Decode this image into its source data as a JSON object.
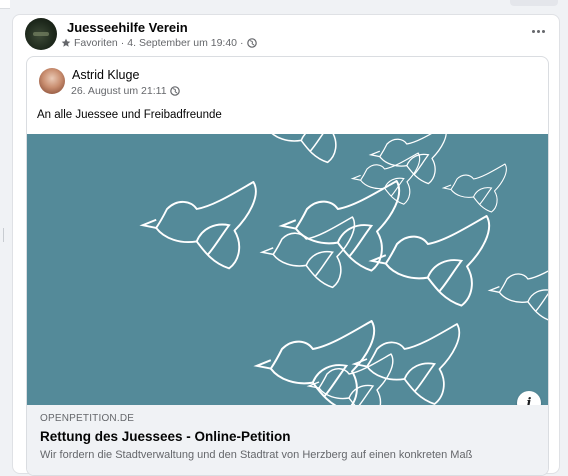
{
  "post": {
    "group_name": "Juesseehilfe Verein",
    "favorites_label": "Favoriten",
    "date": "4. September um 19:40",
    "separator": "·",
    "icons": {
      "favorites": "star-icon",
      "audience": "globe-icon",
      "more": "more-options-icon"
    }
  },
  "shared_post": {
    "author": "Astrid Kluge",
    "date": "26. August um 21:11",
    "separator": "·",
    "text": "An alle Juessee und Freibadfreunde",
    "icons": {
      "audience": "globe-icon"
    }
  },
  "link_preview": {
    "image_description_colors": {
      "background": "#548a99",
      "lines": "#ffffff"
    },
    "domain": "OPENPETITION.DE",
    "title": "Rettung des Juessees - Online-Petition",
    "description": "Wir fordern die Stadtverwaltung und den Stadtrat von Herzberg auf einen konkreten Maß",
    "info_label": "i"
  }
}
